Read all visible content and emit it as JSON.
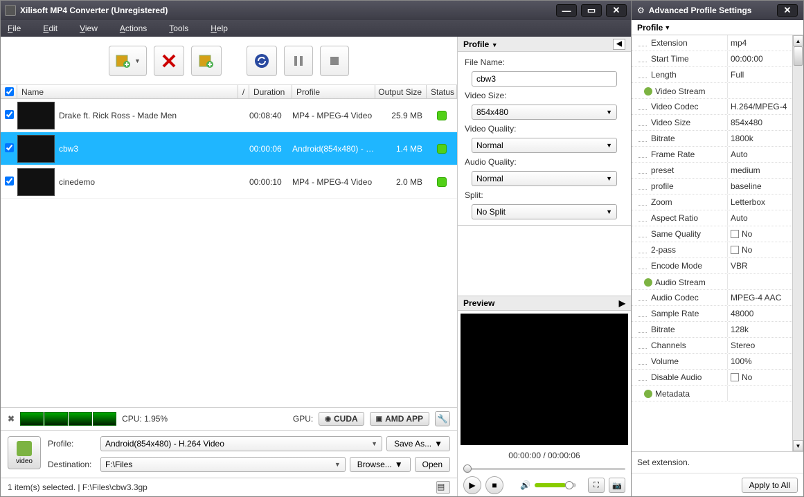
{
  "window": {
    "title": "Xilisoft MP4 Converter (Unregistered)"
  },
  "menu": {
    "file": "File",
    "edit": "Edit",
    "view": "View",
    "actions": "Actions",
    "tools": "Tools",
    "help": "Help"
  },
  "columns": {
    "name": "Name",
    "slash": "/",
    "duration": "Duration",
    "profile": "Profile",
    "outputsize": "Output Size",
    "status": "Status"
  },
  "rows": [
    {
      "name": "Drake ft. Rick Ross - Made Men",
      "duration": "00:08:40",
      "profile": "MP4 - MPEG-4 Video",
      "size": "25.9 MB"
    },
    {
      "name": "cbw3",
      "duration": "00:00:06",
      "profile": "Android(854x480) - H...",
      "size": "1.4 MB"
    },
    {
      "name": "cinedemo",
      "duration": "00:00:10",
      "profile": "MP4 - MPEG-4 Video",
      "size": "2.0 MB"
    }
  ],
  "cpu": {
    "label": "CPU: 1.95%",
    "gpu_label": "GPU:",
    "cuda": "CUDA",
    "amd": "AMD APP"
  },
  "bottom": {
    "profile_label": "Profile:",
    "profile_value": "Android(854x480) - H.264 Video",
    "dest_label": "Destination:",
    "dest_value": "F:\\Files",
    "saveas": "Save As...",
    "browse": "Browse...",
    "open": "Open",
    "video_label": "video"
  },
  "status": {
    "text": "1 item(s) selected.  | F:\\Files\\cbw3.3gp"
  },
  "profile_panel": {
    "title": "Profile",
    "filename_label": "File Name:",
    "filename": "cbw3",
    "videosize_label": "Video Size:",
    "videosize": "854x480",
    "videoqual_label": "Video Quality:",
    "videoqual": "Normal",
    "audioqual_label": "Audio Quality:",
    "audioqual": "Normal",
    "split_label": "Split:",
    "split": "No Split"
  },
  "preview": {
    "title": "Preview",
    "time": "00:00:00 / 00:00:06"
  },
  "adv": {
    "title": "Advanced Profile Settings",
    "profile_label": "Profile",
    "hint": "Set extension.",
    "apply": "Apply to All",
    "rows": [
      {
        "k": "Extension",
        "v": "mp4"
      },
      {
        "k": "Start Time",
        "v": "00:00:00"
      },
      {
        "k": "Length",
        "v": "Full"
      },
      {
        "group": "Video Stream"
      },
      {
        "k": "Video Codec",
        "v": "H.264/MPEG-4"
      },
      {
        "k": "Video Size",
        "v": "854x480"
      },
      {
        "k": "Bitrate",
        "v": "1800k"
      },
      {
        "k": "Frame Rate",
        "v": "Auto"
      },
      {
        "k": "preset",
        "v": "medium"
      },
      {
        "k": "profile",
        "v": "baseline"
      },
      {
        "k": "Zoom",
        "v": "Letterbox"
      },
      {
        "k": "Aspect Ratio",
        "v": "Auto"
      },
      {
        "k": "Same Quality",
        "v": "No",
        "chk": true
      },
      {
        "k": "2-pass",
        "v": "No",
        "chk": true
      },
      {
        "k": "Encode Mode",
        "v": "VBR"
      },
      {
        "group": "Audio Stream"
      },
      {
        "k": "Audio Codec",
        "v": "MPEG-4 AAC"
      },
      {
        "k": "Sample Rate",
        "v": "48000"
      },
      {
        "k": "Bitrate",
        "v": "128k"
      },
      {
        "k": "Channels",
        "v": "Stereo"
      },
      {
        "k": "Volume",
        "v": "100%"
      },
      {
        "k": "Disable Audio",
        "v": "No",
        "chk": true
      },
      {
        "group": "Metadata"
      }
    ]
  }
}
